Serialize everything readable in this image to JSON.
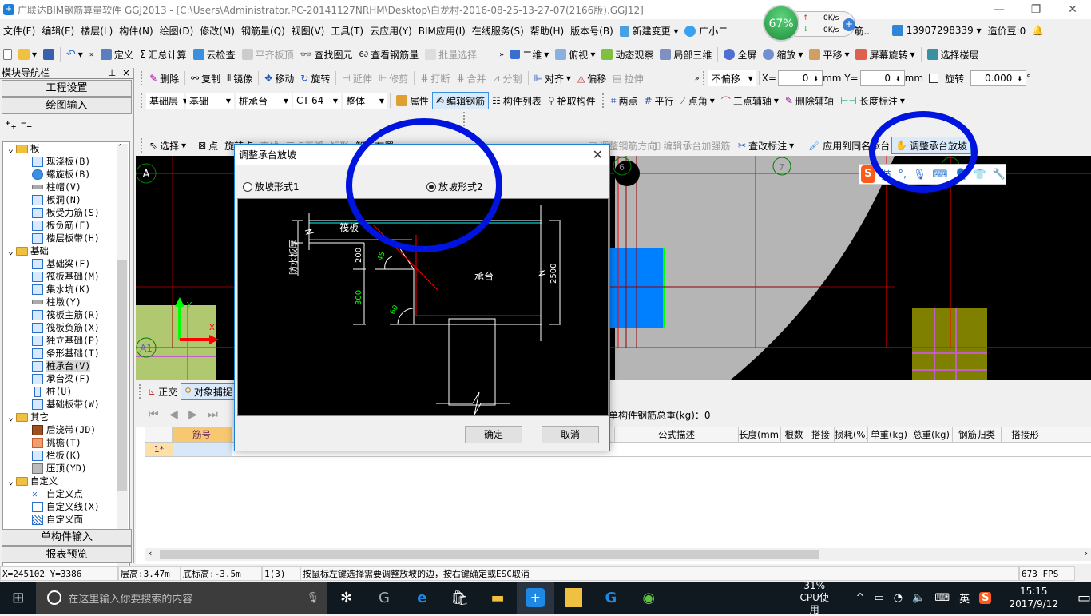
{
  "window": {
    "title": "广联达BIM钢筋算量软件 GGJ2013 - [C:\\Users\\Administrator.PC-20141127NRHM\\Desktop\\白龙村-2016-08-25-13-27-07(2166版).GGJ12]",
    "controls": {
      "minimize": "—",
      "restore": "❐",
      "close": "✕"
    }
  },
  "menu": [
    "文件(F)",
    "编辑(E)",
    "楼层(L)",
    "构件(N)",
    "绘图(D)",
    "修改(M)",
    "钢筋量(Q)",
    "视图(V)",
    "工具(T)",
    "云应用(Y)",
    "BIM应用(I)",
    "在线服务(S)",
    "帮助(H)",
    "版本号(B)"
  ],
  "menu_extra": {
    "new_change": "新建变更",
    "assistant": "广小二",
    "account": "13907298339",
    "beans": "造价豆:0",
    "partial": "筋.."
  },
  "net_widget": {
    "percent": "67%",
    "up": "0K/s",
    "down": "0K/s"
  },
  "toolbar1": {
    "left": [
      "定义",
      "汇总计算",
      "云检查",
      "平齐板顶",
      "查找图元",
      "查看钢筋量",
      "批量选择"
    ],
    "left_disabled": [
      false,
      false,
      false,
      true,
      false,
      false,
      true
    ],
    "right": [
      "二维",
      "俯视",
      "动态观察",
      "局部三维",
      "全屏",
      "缩放",
      "平移",
      "屏幕旋转",
      "选择楼层"
    ]
  },
  "nav_panel": {
    "title": "模块导航栏",
    "pin": "ꟸ",
    "close": "×",
    "buttons": [
      "工程设置",
      "绘图输入"
    ],
    "bottom_buttons": [
      "单构件输入",
      "报表预览"
    ],
    "tree": [
      {
        "group": "板",
        "items": [
          "现浇板(B)",
          "螺旋板(B)",
          "柱帽(V)",
          "板洞(N)",
          "板受力筋(S)",
          "板负筋(F)",
          "楼层板带(H)"
        ]
      },
      {
        "group": "基础",
        "items": [
          "基础梁(F)",
          "筏板基础(M)",
          "集水坑(K)",
          "柱墩(Y)",
          "筏板主筋(R)",
          "筏板负筋(X)",
          "独立基础(P)",
          "条形基础(T)",
          "桩承台(V)",
          "承台梁(F)",
          "桩(U)",
          "基础板带(W)"
        ]
      },
      {
        "group": "其它",
        "items": [
          "后浇带(JD)",
          "挑檐(T)",
          "栏板(K)",
          "压顶(YD)"
        ]
      },
      {
        "group": "自定义",
        "items": [
          "自定义点",
          "自定义线(X)",
          "自定义面"
        ]
      }
    ],
    "selected_item": "桩承台(V)"
  },
  "toolbar2": {
    "items": [
      "删除",
      "复制",
      "镜像",
      "移动",
      "旋转",
      "延伸",
      "修剪",
      "打断",
      "合并",
      "分割",
      "对齐",
      "偏移",
      "拉伸"
    ],
    "disabled": [
      false,
      false,
      false,
      false,
      false,
      true,
      true,
      true,
      true,
      true,
      false,
      false,
      true
    ],
    "offset_mode": "不偏移",
    "x_label": "X=",
    "x_value": "0",
    "y_label": "Y=",
    "y_value": "0",
    "unit": "mm",
    "rotate_label": "旋转",
    "rotate_value": "0.000",
    "degree": "°"
  },
  "toolbar3": {
    "floor": "基础层",
    "category": "基础",
    "type": "桩承台",
    "element": "CT-64",
    "mode": "整体",
    "buttons": [
      "属性",
      "编辑钢筋",
      "构件列表",
      "拾取构件",
      "两点",
      "平行",
      "点角",
      "三点辅轴",
      "删除辅轴",
      "长度标注"
    ]
  },
  "toolbar4": {
    "items": [
      "选择",
      "点",
      "旋转点",
      "直线",
      "三点画弧",
      "矩形",
      "智能布置",
      "调整钢筋方向",
      "编辑承台加强筋",
      "查改标注",
      "应用到同名承台",
      "调整承台放坡"
    ]
  },
  "canvas": {
    "axis_labels": [
      "A",
      "A1",
      "6",
      "7",
      "8"
    ],
    "ime_toolbar": [
      "英",
      "°,",
      "mic",
      "keyboard",
      "user",
      "shirt",
      "wrench"
    ]
  },
  "dialog": {
    "title": "调整承台放坡",
    "close": "✕",
    "options": [
      {
        "label": "放坡形式1",
        "checked": false
      },
      {
        "label": "放坡形式2",
        "checked": true
      }
    ],
    "diagram": {
      "labels": {
        "raft": "筏板",
        "waterproof": "防水板厚",
        "cap": "承台"
      },
      "dims": {
        "d200": "200",
        "d300": "300",
        "d2500": "2500",
        "angle45": "45",
        "angle60": "60"
      }
    },
    "ok": "确定",
    "cancel": "取消"
  },
  "bottom": {
    "snap": [
      "正交",
      "对象捕捉"
    ],
    "total_label": "单构件钢筋总重(kg)：0",
    "columns": [
      "筋号",
      "",
      "",
      "",
      "",
      "公式描述",
      "长度(mm)",
      "根数",
      "搭接",
      "损耗(%)",
      "单重(kg)",
      "总重(kg)",
      "钢筋归类",
      "搭接形"
    ],
    "rows": [
      {
        "index": "1*"
      }
    ]
  },
  "status": {
    "coords": "X=245102 Y=3386",
    "floor_height": "层高:3.47m",
    "bottom_elev": "底标高:-3.5m",
    "count": "1(3)",
    "hint": "按鼠标左键选择需要调整放坡的边，按右键确定或ESC取消",
    "fps": "673 FPS"
  },
  "taskbar": {
    "search_placeholder": "在这里输入你要搜索的内容",
    "cpu_percent": "31%",
    "cpu_label": "CPU使用",
    "ime": "英",
    "time": "15:15",
    "date": "2017/9/12"
  }
}
